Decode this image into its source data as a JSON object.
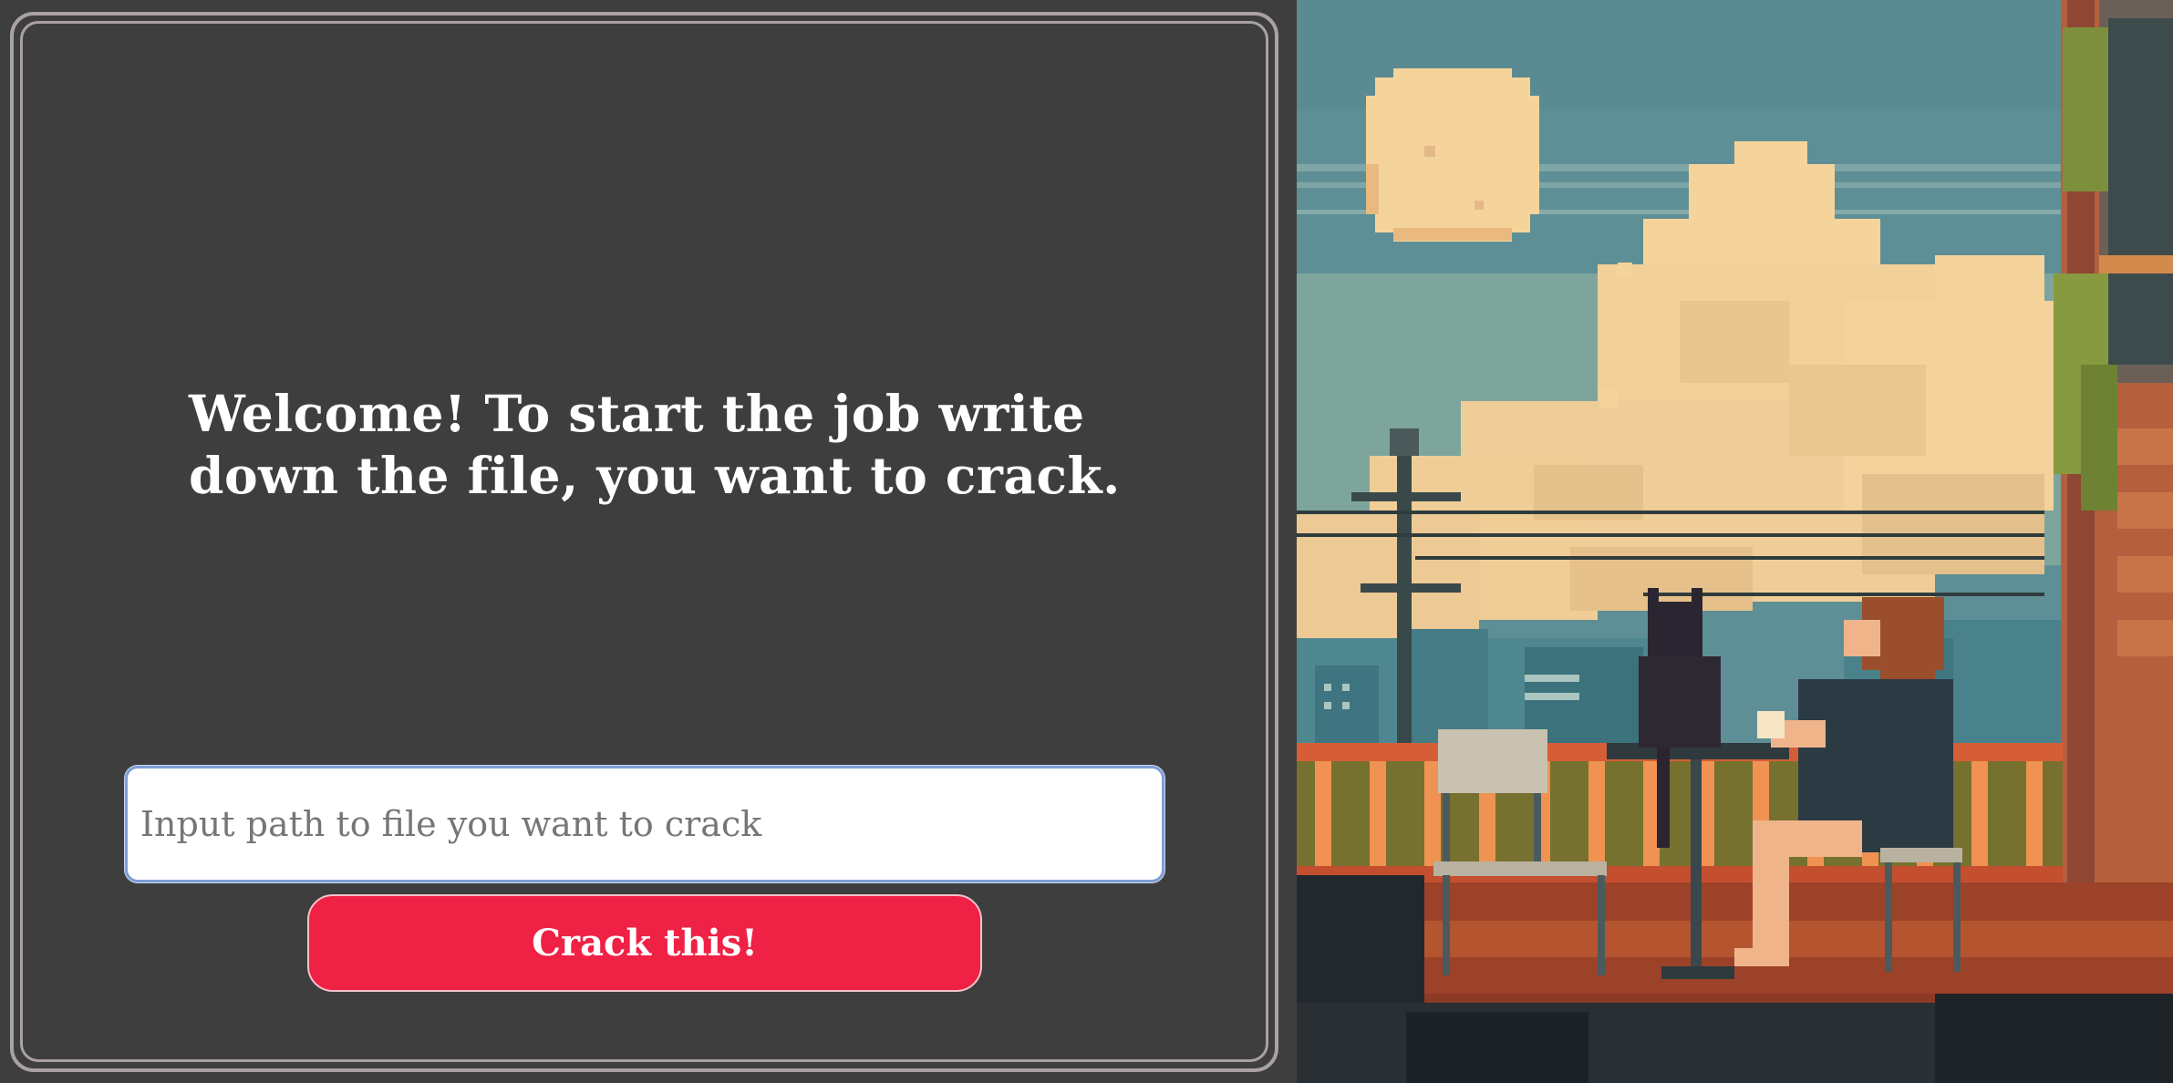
{
  "welcome": {
    "line1": "Welcome! To start the job write",
    "line2": "down the file, you want to crack."
  },
  "file_input": {
    "placeholder": "Input path to file you want to crack",
    "value": ""
  },
  "crack_button": {
    "label": "Crack this!"
  },
  "colors": {
    "panel_bg": "#3e3e3e",
    "frame": "#aaa1a1",
    "button_bg": "#ef2145",
    "input_border": "#7f9ed6",
    "sky": "#6a9aa1",
    "moon": "#f6d69a",
    "clouds": "#f4d49a"
  },
  "artwork": {
    "icon": "pixel-art-rooftop-scene"
  }
}
